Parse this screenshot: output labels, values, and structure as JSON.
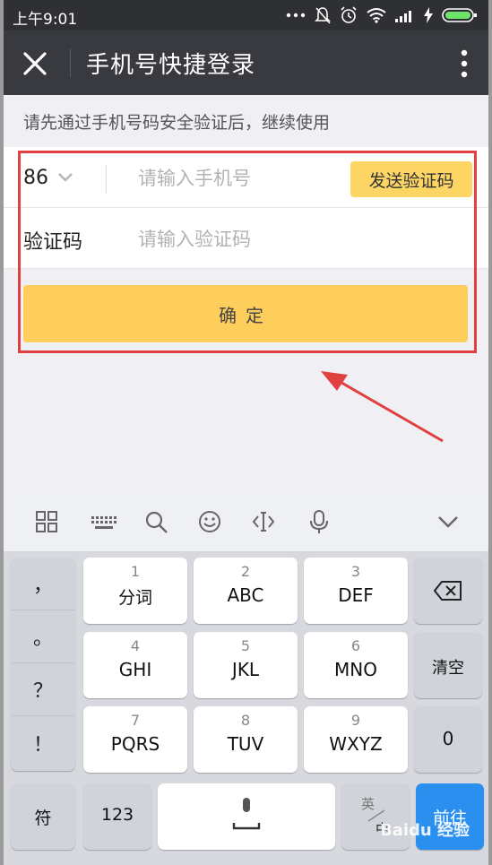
{
  "status_bar": {
    "time": "上午9:01",
    "icons": [
      "more-dots-icon",
      "bell-muted-icon",
      "alarm-icon",
      "wifi-icon",
      "signal-icon",
      "charging-icon",
      "battery-icon"
    ]
  },
  "header": {
    "title": "手机号快捷登录"
  },
  "notice": "请先通过手机号码安全验证后，继续使用",
  "form": {
    "country_code": "86",
    "phone_placeholder": "请输入手机号",
    "send_code_label": "发送验证码",
    "code_label": "验证码",
    "code_placeholder": "请输入验证码",
    "confirm_label": "确定"
  },
  "colors": {
    "accent": "#fece5c",
    "highlight": "#e0403f",
    "titlebar": "#393a3f"
  },
  "keyboard": {
    "toolbar_icons": [
      "apps-grid-icon",
      "keyboard-icon",
      "search-icon",
      "emoji-icon",
      "cursor-icon",
      "microphone-icon",
      "collapse-icon"
    ],
    "punctuation": [
      "，",
      "。",
      "？",
      "！"
    ],
    "keys": [
      {
        "num": "1",
        "label": "分词"
      },
      {
        "num": "2",
        "label": "ABC"
      },
      {
        "num": "3",
        "label": "DEF"
      },
      {
        "num": "4",
        "label": "GHI"
      },
      {
        "num": "5",
        "label": "JKL"
      },
      {
        "num": "6",
        "label": "MNO"
      },
      {
        "num": "7",
        "label": "PQRS"
      },
      {
        "num": "8",
        "label": "TUV"
      },
      {
        "num": "9",
        "label": "WXYZ"
      }
    ],
    "clear_label": "清空",
    "zero_label": "0",
    "symbol_label": "符",
    "num_label": "123",
    "lang_top": "英",
    "lang_bottom": "中",
    "go_label": "前往"
  },
  "watermark": "Baidu 经验"
}
